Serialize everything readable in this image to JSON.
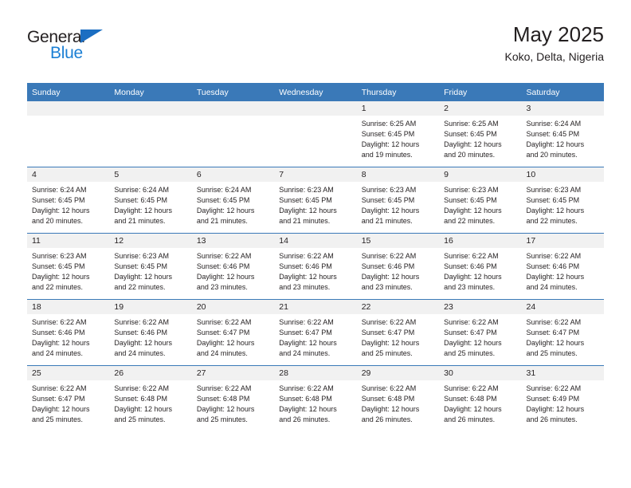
{
  "brand": {
    "name_top": "General",
    "name_bottom": "Blue",
    "triangle_color": "#1b6ec2",
    "blue_color": "#1b7fd4"
  },
  "header": {
    "title": "May 2025",
    "subtitle": "Koko, Delta, Nigeria"
  },
  "colors": {
    "header_blue": "#3a79b8",
    "daynum_gray": "#f1f1f1",
    "text": "#231f20"
  },
  "weekday_headers": [
    "Sunday",
    "Monday",
    "Tuesday",
    "Wednesday",
    "Thursday",
    "Friday",
    "Saturday"
  ],
  "weeks": [
    [
      {
        "day": "",
        "empty": true,
        "sunrise": "",
        "sunset": "",
        "daylight_line1": "",
        "daylight_line2": ""
      },
      {
        "day": "",
        "empty": true,
        "sunrise": "",
        "sunset": "",
        "daylight_line1": "",
        "daylight_line2": ""
      },
      {
        "day": "",
        "empty": true,
        "sunrise": "",
        "sunset": "",
        "daylight_line1": "",
        "daylight_line2": ""
      },
      {
        "day": "",
        "empty": true,
        "sunrise": "",
        "sunset": "",
        "daylight_line1": "",
        "daylight_line2": ""
      },
      {
        "day": "1",
        "empty": false,
        "sunrise": "Sunrise: 6:25 AM",
        "sunset": "Sunset: 6:45 PM",
        "daylight_line1": "Daylight: 12 hours",
        "daylight_line2": "and 19 minutes."
      },
      {
        "day": "2",
        "empty": false,
        "sunrise": "Sunrise: 6:25 AM",
        "sunset": "Sunset: 6:45 PM",
        "daylight_line1": "Daylight: 12 hours",
        "daylight_line2": "and 20 minutes."
      },
      {
        "day": "3",
        "empty": false,
        "sunrise": "Sunrise: 6:24 AM",
        "sunset": "Sunset: 6:45 PM",
        "daylight_line1": "Daylight: 12 hours",
        "daylight_line2": "and 20 minutes."
      }
    ],
    [
      {
        "day": "4",
        "empty": false,
        "sunrise": "Sunrise: 6:24 AM",
        "sunset": "Sunset: 6:45 PM",
        "daylight_line1": "Daylight: 12 hours",
        "daylight_line2": "and 20 minutes."
      },
      {
        "day": "5",
        "empty": false,
        "sunrise": "Sunrise: 6:24 AM",
        "sunset": "Sunset: 6:45 PM",
        "daylight_line1": "Daylight: 12 hours",
        "daylight_line2": "and 21 minutes."
      },
      {
        "day": "6",
        "empty": false,
        "sunrise": "Sunrise: 6:24 AM",
        "sunset": "Sunset: 6:45 PM",
        "daylight_line1": "Daylight: 12 hours",
        "daylight_line2": "and 21 minutes."
      },
      {
        "day": "7",
        "empty": false,
        "sunrise": "Sunrise: 6:23 AM",
        "sunset": "Sunset: 6:45 PM",
        "daylight_line1": "Daylight: 12 hours",
        "daylight_line2": "and 21 minutes."
      },
      {
        "day": "8",
        "empty": false,
        "sunrise": "Sunrise: 6:23 AM",
        "sunset": "Sunset: 6:45 PM",
        "daylight_line1": "Daylight: 12 hours",
        "daylight_line2": "and 21 minutes."
      },
      {
        "day": "9",
        "empty": false,
        "sunrise": "Sunrise: 6:23 AM",
        "sunset": "Sunset: 6:45 PM",
        "daylight_line1": "Daylight: 12 hours",
        "daylight_line2": "and 22 minutes."
      },
      {
        "day": "10",
        "empty": false,
        "sunrise": "Sunrise: 6:23 AM",
        "sunset": "Sunset: 6:45 PM",
        "daylight_line1": "Daylight: 12 hours",
        "daylight_line2": "and 22 minutes."
      }
    ],
    [
      {
        "day": "11",
        "empty": false,
        "sunrise": "Sunrise: 6:23 AM",
        "sunset": "Sunset: 6:45 PM",
        "daylight_line1": "Daylight: 12 hours",
        "daylight_line2": "and 22 minutes."
      },
      {
        "day": "12",
        "empty": false,
        "sunrise": "Sunrise: 6:23 AM",
        "sunset": "Sunset: 6:45 PM",
        "daylight_line1": "Daylight: 12 hours",
        "daylight_line2": "and 22 minutes."
      },
      {
        "day": "13",
        "empty": false,
        "sunrise": "Sunrise: 6:22 AM",
        "sunset": "Sunset: 6:46 PM",
        "daylight_line1": "Daylight: 12 hours",
        "daylight_line2": "and 23 minutes."
      },
      {
        "day": "14",
        "empty": false,
        "sunrise": "Sunrise: 6:22 AM",
        "sunset": "Sunset: 6:46 PM",
        "daylight_line1": "Daylight: 12 hours",
        "daylight_line2": "and 23 minutes."
      },
      {
        "day": "15",
        "empty": false,
        "sunrise": "Sunrise: 6:22 AM",
        "sunset": "Sunset: 6:46 PM",
        "daylight_line1": "Daylight: 12 hours",
        "daylight_line2": "and 23 minutes."
      },
      {
        "day": "16",
        "empty": false,
        "sunrise": "Sunrise: 6:22 AM",
        "sunset": "Sunset: 6:46 PM",
        "daylight_line1": "Daylight: 12 hours",
        "daylight_line2": "and 23 minutes."
      },
      {
        "day": "17",
        "empty": false,
        "sunrise": "Sunrise: 6:22 AM",
        "sunset": "Sunset: 6:46 PM",
        "daylight_line1": "Daylight: 12 hours",
        "daylight_line2": "and 24 minutes."
      }
    ],
    [
      {
        "day": "18",
        "empty": false,
        "sunrise": "Sunrise: 6:22 AM",
        "sunset": "Sunset: 6:46 PM",
        "daylight_line1": "Daylight: 12 hours",
        "daylight_line2": "and 24 minutes."
      },
      {
        "day": "19",
        "empty": false,
        "sunrise": "Sunrise: 6:22 AM",
        "sunset": "Sunset: 6:46 PM",
        "daylight_line1": "Daylight: 12 hours",
        "daylight_line2": "and 24 minutes."
      },
      {
        "day": "20",
        "empty": false,
        "sunrise": "Sunrise: 6:22 AM",
        "sunset": "Sunset: 6:47 PM",
        "daylight_line1": "Daylight: 12 hours",
        "daylight_line2": "and 24 minutes."
      },
      {
        "day": "21",
        "empty": false,
        "sunrise": "Sunrise: 6:22 AM",
        "sunset": "Sunset: 6:47 PM",
        "daylight_line1": "Daylight: 12 hours",
        "daylight_line2": "and 24 minutes."
      },
      {
        "day": "22",
        "empty": false,
        "sunrise": "Sunrise: 6:22 AM",
        "sunset": "Sunset: 6:47 PM",
        "daylight_line1": "Daylight: 12 hours",
        "daylight_line2": "and 25 minutes."
      },
      {
        "day": "23",
        "empty": false,
        "sunrise": "Sunrise: 6:22 AM",
        "sunset": "Sunset: 6:47 PM",
        "daylight_line1": "Daylight: 12 hours",
        "daylight_line2": "and 25 minutes."
      },
      {
        "day": "24",
        "empty": false,
        "sunrise": "Sunrise: 6:22 AM",
        "sunset": "Sunset: 6:47 PM",
        "daylight_line1": "Daylight: 12 hours",
        "daylight_line2": "and 25 minutes."
      }
    ],
    [
      {
        "day": "25",
        "empty": false,
        "sunrise": "Sunrise: 6:22 AM",
        "sunset": "Sunset: 6:47 PM",
        "daylight_line1": "Daylight: 12 hours",
        "daylight_line2": "and 25 minutes."
      },
      {
        "day": "26",
        "empty": false,
        "sunrise": "Sunrise: 6:22 AM",
        "sunset": "Sunset: 6:48 PM",
        "daylight_line1": "Daylight: 12 hours",
        "daylight_line2": "and 25 minutes."
      },
      {
        "day": "27",
        "empty": false,
        "sunrise": "Sunrise: 6:22 AM",
        "sunset": "Sunset: 6:48 PM",
        "daylight_line1": "Daylight: 12 hours",
        "daylight_line2": "and 25 minutes."
      },
      {
        "day": "28",
        "empty": false,
        "sunrise": "Sunrise: 6:22 AM",
        "sunset": "Sunset: 6:48 PM",
        "daylight_line1": "Daylight: 12 hours",
        "daylight_line2": "and 26 minutes."
      },
      {
        "day": "29",
        "empty": false,
        "sunrise": "Sunrise: 6:22 AM",
        "sunset": "Sunset: 6:48 PM",
        "daylight_line1": "Daylight: 12 hours",
        "daylight_line2": "and 26 minutes."
      },
      {
        "day": "30",
        "empty": false,
        "sunrise": "Sunrise: 6:22 AM",
        "sunset": "Sunset: 6:48 PM",
        "daylight_line1": "Daylight: 12 hours",
        "daylight_line2": "and 26 minutes."
      },
      {
        "day": "31",
        "empty": false,
        "sunrise": "Sunrise: 6:22 AM",
        "sunset": "Sunset: 6:49 PM",
        "daylight_line1": "Daylight: 12 hours",
        "daylight_line2": "and 26 minutes."
      }
    ]
  ]
}
